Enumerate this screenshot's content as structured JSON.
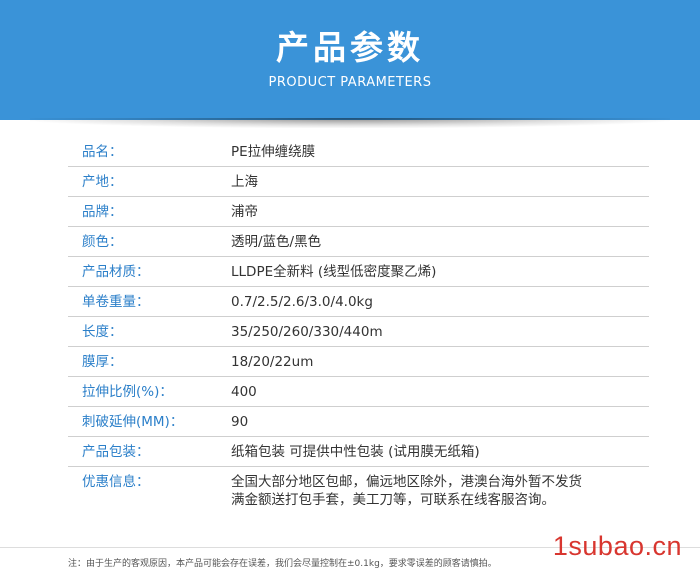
{
  "header": {
    "title": "产品参数",
    "subtitle": "PRODUCT PARAMETERS"
  },
  "params": [
    {
      "label": "品名：",
      "value": "PE拉伸缠绕膜"
    },
    {
      "label": "产地：",
      "value": "上海"
    },
    {
      "label": "品牌：",
      "value": "浦帝"
    },
    {
      "label": "颜色：",
      "value": "透明/蓝色/黑色"
    },
    {
      "label": "产品材质：",
      "value": "LLDPE全新料 (线型低密度聚乙烯)"
    },
    {
      "label": "单卷重量：",
      "value": "0.7/2.5/2.6/3.0/4.0kg"
    },
    {
      "label": "长度：",
      "value": "35/250/260/330/440m"
    },
    {
      "label": "膜厚：",
      "value": "18/20/22um"
    },
    {
      "label": "拉伸比例(%)：",
      "value": "400"
    },
    {
      "label": "刺破延伸(MM)：",
      "value": "90"
    },
    {
      "label": "产品包装：",
      "value": "纸箱包装  可提供中性包装 (试用膜无纸箱)"
    }
  ],
  "promo": {
    "label": "优惠信息：",
    "line1": "全国大部分地区包邮，偏远地区除外，港澳台海外暂不发货",
    "line2": "满金额送打包手套，美工刀等，可联系在线客服咨询。"
  },
  "footnote": "注：由于生产的客观原因，本产品可能会存在误差，我们会尽量控制在±0.1kg，要求零误差的顾客请慎拍。",
  "watermark": "1subao.cn",
  "colors": {
    "banner": "#3a93d8",
    "label": "#2b7fc9",
    "watermark": "#d8362f"
  }
}
